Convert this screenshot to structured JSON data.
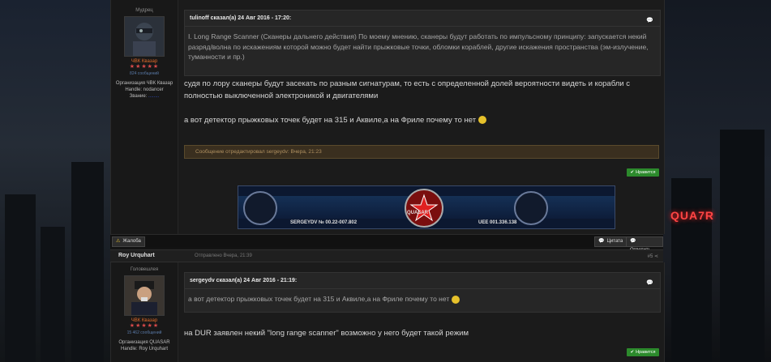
{
  "post1": {
    "author": {
      "rank_title": "Мудрец",
      "clan": "ЧВК Квазар",
      "stars": "★★★★★",
      "posts_count": "824 сообщений",
      "org_line": "Организация ЧВК Квазар",
      "handle": "Handle: nodancer",
      "rank_label": "Звание:",
      "rank_value": "........"
    },
    "quote": {
      "header": "tulinoff сказал(а) 24 Авг 2016 - 17:20:",
      "body": "I. Long Range Scanner (Сканеры дальнего действия) По моему мнению, сканеры будут работать по импульсному принципу: запускается некий разряд/волна по искажениям которой можно будет найти прыжковые точки, обломки кораблей, другие искажения пространства (эм-излучение, туманности и пр.)"
    },
    "text_1": "судя по лору сканеры будут засекать по разным сигнатурам, то есть с определенной долей вероятности видеть и корабли с полностью выключенной электроникой и двигателями",
    "text_2": "а вот детектор прыжковых точек будет на 315 и Аквиле,а на Фриле почему то нет",
    "edited": "Сообщение отредактировал sergeydv: Вчера, 21:23",
    "like_label": "Нравится",
    "signature": {
      "left_id": "SERGEYDV № 00.22-007.802",
      "center": "QUASAR",
      "right_id": "UEE 001.336.138"
    }
  },
  "toolbar": {
    "report_label": "Жалоба",
    "quote_label": "Цитата",
    "reply_label": "Ответить"
  },
  "post2_bar": {
    "author": "Roy Urquhart",
    "time": "Отправлено Вчера, 21:39",
    "number": "#5"
  },
  "post2": {
    "author": {
      "rank_title": "Головешлея",
      "clan": "ЧВК Квазар",
      "stars": "★★★★★",
      "posts_count": "15 462 сообщений",
      "org_line": "Организация QUASAR",
      "handle": "Handle: Roy Urquhart"
    },
    "quote": {
      "header": "sergeydv сказал(а) 24 Авг 2016 - 21:19:",
      "body": "а вот детектор прыжковых точек будет на 315 и Аквиле,а на Фриле почему то нет"
    },
    "text_1": "на DUR заявлен некий \"long range scanner\" возможно у него будет такой режим",
    "like_label": "Нравится"
  },
  "background": {
    "neon_sign": "QUA7R"
  },
  "colors": {
    "like_green": "#2c8a2c",
    "clan_orange": "#e06a2a",
    "star_red": "#d84a4a",
    "edited_bg": "#3a2f1f"
  }
}
